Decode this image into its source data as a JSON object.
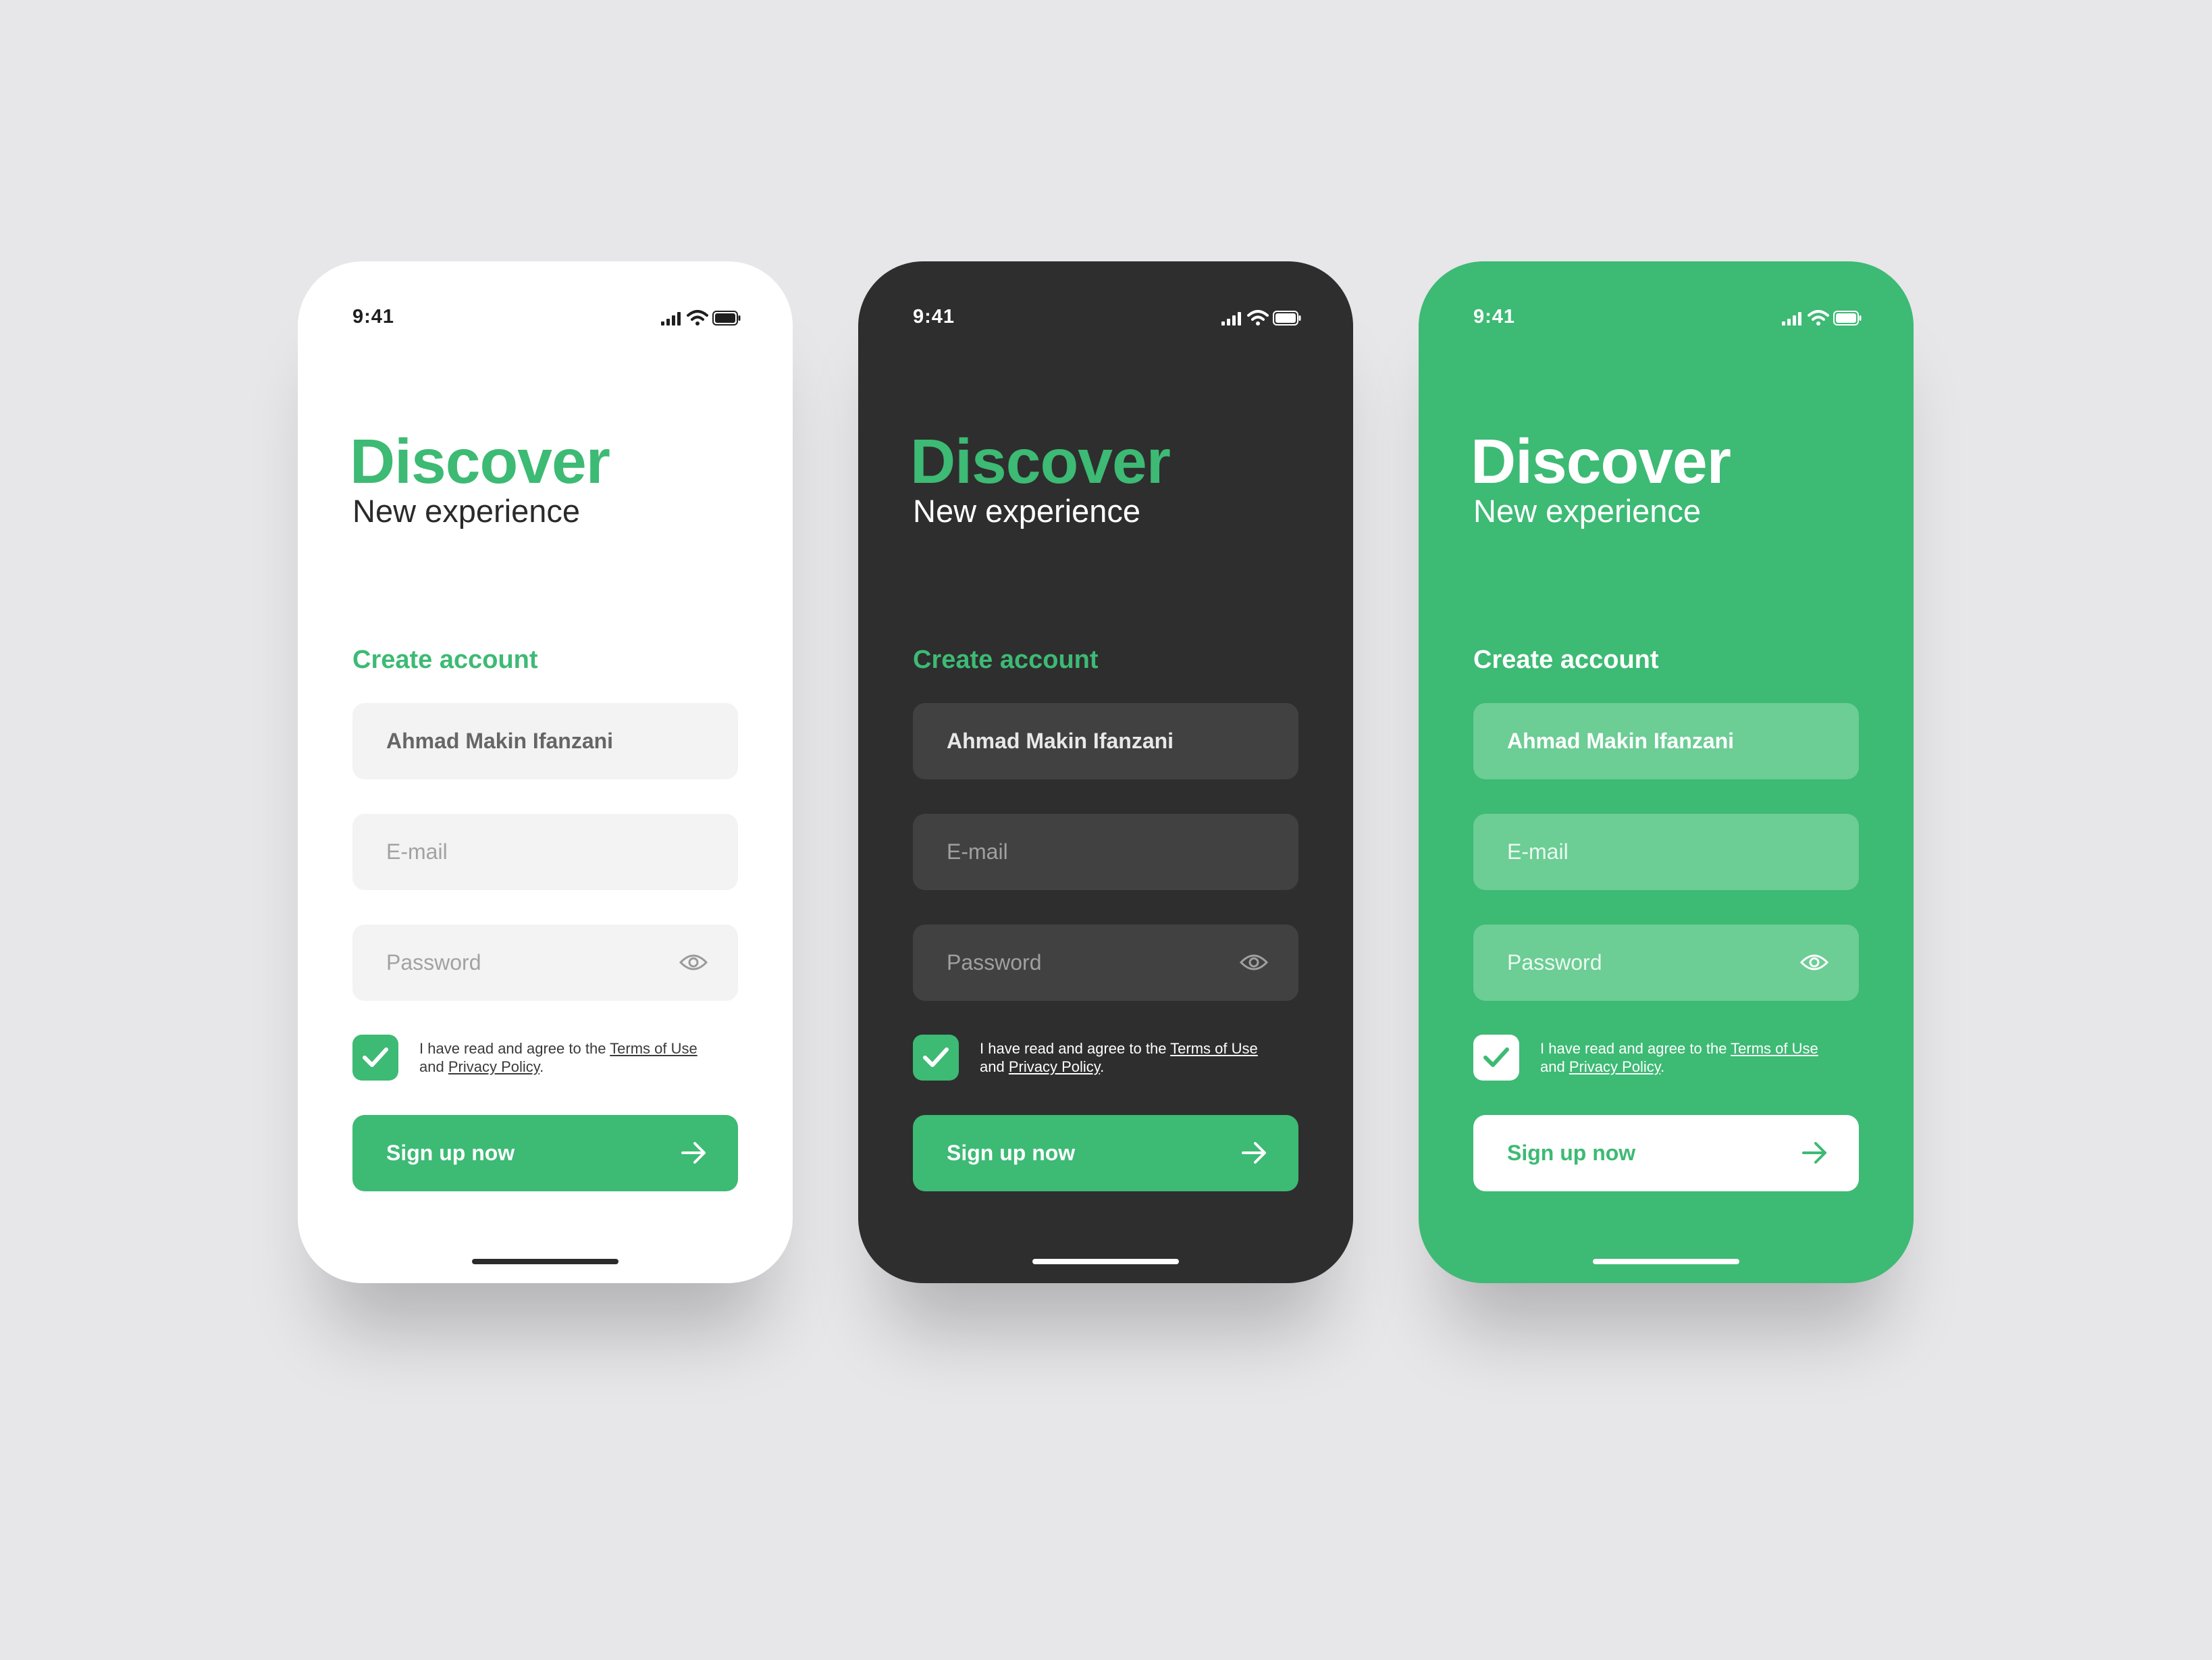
{
  "colors": {
    "background": "#e7e6e9",
    "accent_green": "#3dba74",
    "dark_surface": "#2e2e2e",
    "light_surface": "#ffffff"
  },
  "screens": [
    {
      "theme": "light",
      "status": {
        "time": "9:41",
        "icons": [
          "signal-icon",
          "wifi-icon",
          "battery-icon"
        ]
      },
      "heading": "Discover",
      "subheading": "New experience",
      "section_title": "Create account",
      "name_field": {
        "value": "Ahmad Makin Ifanzani"
      },
      "email_field": {
        "placeholder": "E-mail"
      },
      "password_field": {
        "placeholder": "Password",
        "icon": "eye-icon"
      },
      "terms": {
        "checked": true,
        "text": "I have read and agree to the",
        "terms_link": "Terms of Use",
        "and_text": "and",
        "privacy_link": "Privacy Policy",
        "period": "."
      },
      "signup_button": {
        "label": "Sign up now",
        "icon": "arrow-right-icon"
      }
    },
    {
      "theme": "dark",
      "status": {
        "time": "9:41",
        "icons": [
          "signal-icon",
          "wifi-icon",
          "battery-icon"
        ]
      },
      "heading": "Discover",
      "subheading": "New experience",
      "section_title": "Create account",
      "name_field": {
        "value": "Ahmad Makin Ifanzani"
      },
      "email_field": {
        "placeholder": "E-mail"
      },
      "password_field": {
        "placeholder": "Password",
        "icon": "eye-icon"
      },
      "terms": {
        "checked": true,
        "text": "I have read and agree to the",
        "terms_link": "Terms of Use",
        "and_text": "and",
        "privacy_link": "Privacy Policy",
        "period": "."
      },
      "signup_button": {
        "label": "Sign up now",
        "icon": "arrow-right-icon"
      }
    },
    {
      "theme": "green",
      "status": {
        "time": "9:41",
        "icons": [
          "signal-icon",
          "wifi-icon",
          "battery-icon"
        ]
      },
      "heading": "Discover",
      "subheading": "New experience",
      "section_title": "Create account",
      "name_field": {
        "value": "Ahmad Makin Ifanzani"
      },
      "email_field": {
        "placeholder": "E-mail"
      },
      "password_field": {
        "placeholder": "Password",
        "icon": "eye-icon"
      },
      "terms": {
        "checked": true,
        "text": "I have read and agree to the",
        "terms_link": "Terms of Use",
        "and_text": "and",
        "privacy_link": "Privacy Policy",
        "period": "."
      },
      "signup_button": {
        "label": "Sign up now",
        "icon": "arrow-right-icon"
      }
    }
  ]
}
